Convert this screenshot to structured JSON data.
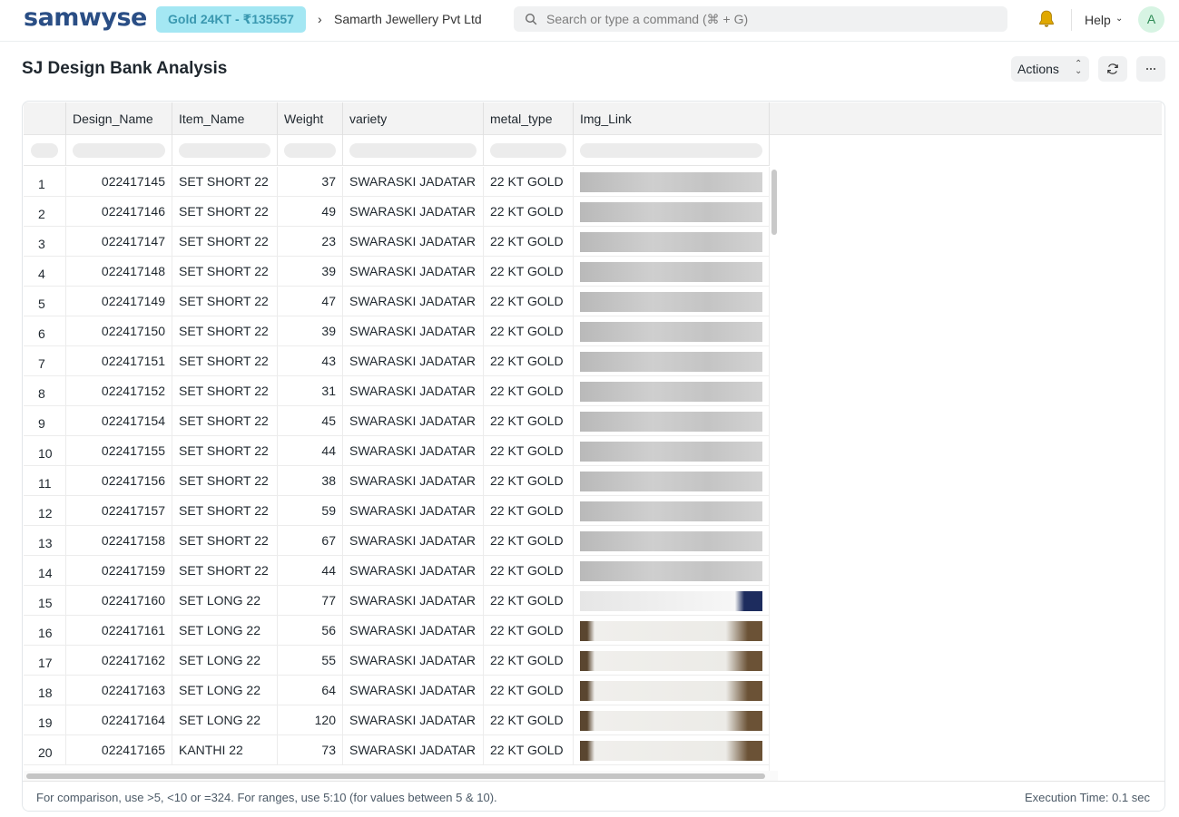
{
  "navbar": {
    "logo": "samwyse",
    "gold_badge": "Gold 24KT - ₹135557",
    "breadcrumb": "Samarth Jewellery Pvt Ltd",
    "search_placeholder": "Search or type a command (⌘ + G)",
    "help_label": "Help",
    "avatar_initial": "A"
  },
  "page": {
    "title": "SJ Design Bank Analysis",
    "actions_label": "Actions"
  },
  "table": {
    "columns": [
      "Design_Name",
      "Item_Name",
      "Weight",
      "variety",
      "metal_type",
      "Img_Link"
    ],
    "rows": [
      {
        "idx": "1",
        "design": "022417145",
        "item": "SET SHORT 22",
        "weight": "37",
        "variety": "SWARASKI JADATAR",
        "metal": "22 KT GOLD",
        "img": "grey"
      },
      {
        "idx": "2",
        "design": "022417146",
        "item": "SET SHORT 22",
        "weight": "49",
        "variety": "SWARASKI JADATAR",
        "metal": "22 KT GOLD",
        "img": "grey"
      },
      {
        "idx": "3",
        "design": "022417147",
        "item": "SET SHORT 22",
        "weight": "23",
        "variety": "SWARASKI JADATAR",
        "metal": "22 KT GOLD",
        "img": "grey"
      },
      {
        "idx": "4",
        "design": "022417148",
        "item": "SET SHORT 22",
        "weight": "39",
        "variety": "SWARASKI JADATAR",
        "metal": "22 KT GOLD",
        "img": "grey"
      },
      {
        "idx": "5",
        "design": "022417149",
        "item": "SET SHORT 22",
        "weight": "47",
        "variety": "SWARASKI JADATAR",
        "metal": "22 KT GOLD",
        "img": "grey"
      },
      {
        "idx": "6",
        "design": "022417150",
        "item": "SET SHORT 22",
        "weight": "39",
        "variety": "SWARASKI JADATAR",
        "metal": "22 KT GOLD",
        "img": "grey"
      },
      {
        "idx": "7",
        "design": "022417151",
        "item": "SET SHORT 22",
        "weight": "43",
        "variety": "SWARASKI JADATAR",
        "metal": "22 KT GOLD",
        "img": "grey"
      },
      {
        "idx": "8",
        "design": "022417152",
        "item": "SET SHORT 22",
        "weight": "31",
        "variety": "SWARASKI JADATAR",
        "metal": "22 KT GOLD",
        "img": "grey"
      },
      {
        "idx": "9",
        "design": "022417154",
        "item": "SET SHORT 22",
        "weight": "45",
        "variety": "SWARASKI JADATAR",
        "metal": "22 KT GOLD",
        "img": "grey"
      },
      {
        "idx": "10",
        "design": "022417155",
        "item": "SET SHORT 22",
        "weight": "44",
        "variety": "SWARASKI JADATAR",
        "metal": "22 KT GOLD",
        "img": "grey"
      },
      {
        "idx": "11",
        "design": "022417156",
        "item": "SET SHORT 22",
        "weight": "38",
        "variety": "SWARASKI JADATAR",
        "metal": "22 KT GOLD",
        "img": "grey"
      },
      {
        "idx": "12",
        "design": "022417157",
        "item": "SET SHORT 22",
        "weight": "59",
        "variety": "SWARASKI JADATAR",
        "metal": "22 KT GOLD",
        "img": "grey"
      },
      {
        "idx": "13",
        "design": "022417158",
        "item": "SET SHORT 22",
        "weight": "67",
        "variety": "SWARASKI JADATAR",
        "metal": "22 KT GOLD",
        "img": "grey"
      },
      {
        "idx": "14",
        "design": "022417159",
        "item": "SET SHORT 22",
        "weight": "44",
        "variety": "SWARASKI JADATAR",
        "metal": "22 KT GOLD",
        "img": "grey"
      },
      {
        "idx": "15",
        "design": "022417160",
        "item": "SET LONG 22",
        "weight": "77",
        "variety": "SWARASKI JADATAR",
        "metal": "22 KT GOLD",
        "img": "white"
      },
      {
        "idx": "16",
        "design": "022417161",
        "item": "SET LONG 22",
        "weight": "56",
        "variety": "SWARASKI JADATAR",
        "metal": "22 KT GOLD",
        "img": "brown"
      },
      {
        "idx": "17",
        "design": "022417162",
        "item": "SET LONG 22",
        "weight": "55",
        "variety": "SWARASKI JADATAR",
        "metal": "22 KT GOLD",
        "img": "brown"
      },
      {
        "idx": "18",
        "design": "022417163",
        "item": "SET LONG 22",
        "weight": "64",
        "variety": "SWARASKI JADATAR",
        "metal": "22 KT GOLD",
        "img": "brown"
      },
      {
        "idx": "19",
        "design": "022417164",
        "item": "SET LONG 22",
        "weight": "120",
        "variety": "SWARASKI JADATAR",
        "metal": "22 KT GOLD",
        "img": "brown"
      },
      {
        "idx": "20",
        "design": "022417165",
        "item": "KANTHI 22",
        "weight": "73",
        "variety": "SWARASKI JADATAR",
        "metal": "22 KT GOLD",
        "img": "brown"
      }
    ]
  },
  "footer": {
    "hint": "For comparison, use >5, <10 or =324. For ranges, use 5:10 (for values between 5 & 10).",
    "exec_time": "Execution Time: 0.1 sec"
  },
  "colors": {
    "brand": "#2a4e85",
    "gold_badge_bg": "#a4e7f3",
    "gold_badge_text": "#3a98b0",
    "bell": "#e0a800"
  },
  "icons": [
    "search-icon",
    "bell-icon",
    "chevron-down-icon",
    "sort-icon",
    "refresh-icon",
    "more-icon"
  ]
}
